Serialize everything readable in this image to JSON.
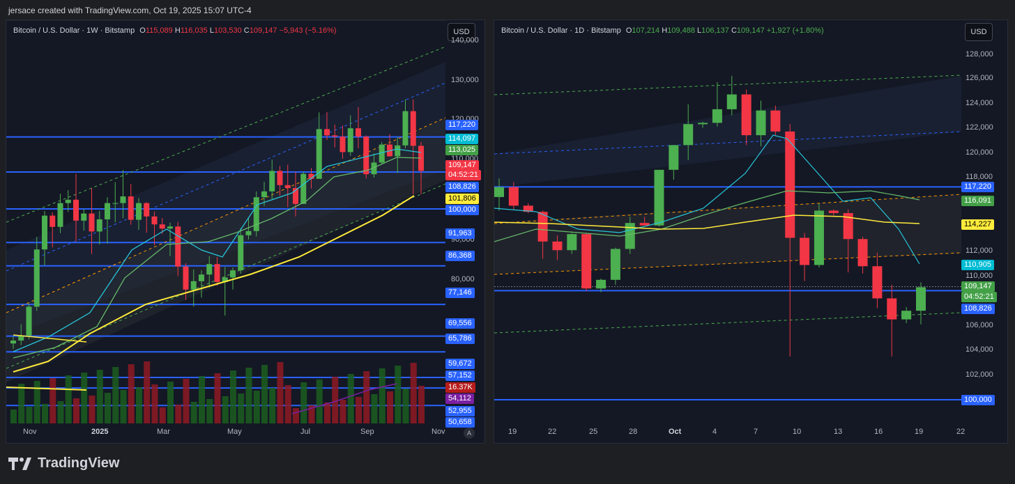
{
  "header": {
    "caption": "jersace created with TradingView.com, Oct 19, 2025 15:07 UTC-4"
  },
  "colors": {
    "up": "#26a69a",
    "up_fill": "#4caf50",
    "down": "#f23645",
    "level": "#2962ff",
    "sma_yellow": "#ffeb3b",
    "ema_cyan": "#26c6da",
    "ema_green": "#66bb6a"
  },
  "left_chart": {
    "symbol": "Bitcoin / U.S. Dollar · 1W · Bitstamp",
    "o_label": "O",
    "o_val": "115,089",
    "h_label": "H",
    "h_val": "116,035",
    "l_label": "L",
    "l_val": "103,530",
    "c_label": "C",
    "c_val": "109,147",
    "change": "−5,943 (−5.16%)",
    "currency": "USD",
    "x_labels": [
      "Nov",
      "2025",
      "Mar",
      "May",
      "Jul",
      "Sep",
      "Nov"
    ],
    "scale_button": "A",
    "y_ticks": [
      "140,000",
      "130,000",
      "120,000",
      "110,000",
      "90,000",
      "80,000"
    ],
    "price_tags": [
      {
        "text": "117,220",
        "kind": "level"
      },
      {
        "text": "114,097",
        "kind": "cyan"
      },
      {
        "text": "113,025",
        "kind": "green"
      },
      {
        "text": "109,147",
        "kind": "price"
      },
      {
        "text": "04:52:21",
        "kind": "price"
      },
      {
        "text": "108,826",
        "kind": "level"
      },
      {
        "text": "101,806",
        "kind": "yellow"
      },
      {
        "text": "100,000",
        "kind": "level"
      },
      {
        "text": "91,963",
        "kind": "level"
      },
      {
        "text": "86,368",
        "kind": "level"
      },
      {
        "text": "77,146",
        "kind": "level"
      },
      {
        "text": "69,556",
        "kind": "level"
      },
      {
        "text": "65,786",
        "kind": "level"
      },
      {
        "text": "59,672",
        "kind": "level"
      },
      {
        "text": "57,152",
        "kind": "level"
      },
      {
        "text": "16.37K",
        "kind": "volume"
      },
      {
        "text": "54,112",
        "kind": "purple"
      },
      {
        "text": "52,955",
        "kind": "level"
      },
      {
        "text": "50,658",
        "kind": "level"
      }
    ]
  },
  "right_chart": {
    "symbol": "Bitcoin / U.S. Dollar · 1D · Bitstamp",
    "o_label": "O",
    "o_val": "107,214",
    "h_label": "H",
    "h_val": "109,488",
    "l_label": "L",
    "l_val": "106,137",
    "c_label": "C",
    "c_val": "109,147",
    "change": "+1,927 (+1.80%)",
    "currency": "USD",
    "x_labels": [
      "19",
      "22",
      "25",
      "28",
      "Oct",
      "4",
      "7",
      "10",
      "13",
      "16",
      "19",
      "22"
    ],
    "y_ticks": [
      "128,000",
      "126,000",
      "124,000",
      "122,000",
      "120,000",
      "118,000",
      "112,000",
      "110,000",
      "106,000",
      "104,000",
      "102,000"
    ],
    "price_tags": [
      {
        "text": "117,220",
        "kind": "level"
      },
      {
        "text": "116,091",
        "kind": "green"
      },
      {
        "text": "114,227",
        "kind": "yellow"
      },
      {
        "text": "110,905",
        "kind": "cyan"
      },
      {
        "text": "109,147",
        "kind": "up"
      },
      {
        "text": "04:52:21",
        "kind": "up"
      },
      {
        "text": "108,826",
        "kind": "level"
      },
      {
        "text": "100,000",
        "kind": "level"
      }
    ]
  },
  "footer": {
    "brand": "TradingView"
  }
}
